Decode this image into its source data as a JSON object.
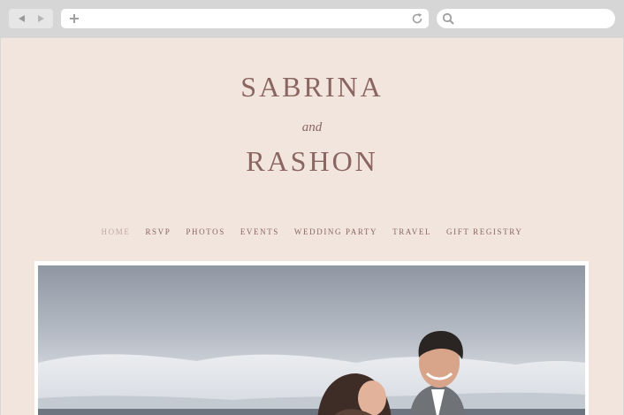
{
  "browser": {
    "back_icon": "triangle-left-icon",
    "forward_icon": "triangle-right-icon",
    "new_tab_icon": "plus-icon",
    "reload_icon": "reload-icon",
    "search_icon": "magnifier-icon"
  },
  "site": {
    "first_name": "SABRINA",
    "conjunction": "and",
    "second_name": "RASHON"
  },
  "nav": {
    "items": [
      {
        "label": "HOME"
      },
      {
        "label": "RSVP"
      },
      {
        "label": "PHOTOS"
      },
      {
        "label": "EVENTS"
      },
      {
        "label": "WEDDING PARTY"
      },
      {
        "label": "TRAVEL"
      },
      {
        "label": "GIFT REGISTRY"
      }
    ],
    "active_index": 0
  },
  "colors": {
    "page_bg": "#f1e5de",
    "accent": "#8b6660",
    "nav_active": "#c4a7a2"
  }
}
